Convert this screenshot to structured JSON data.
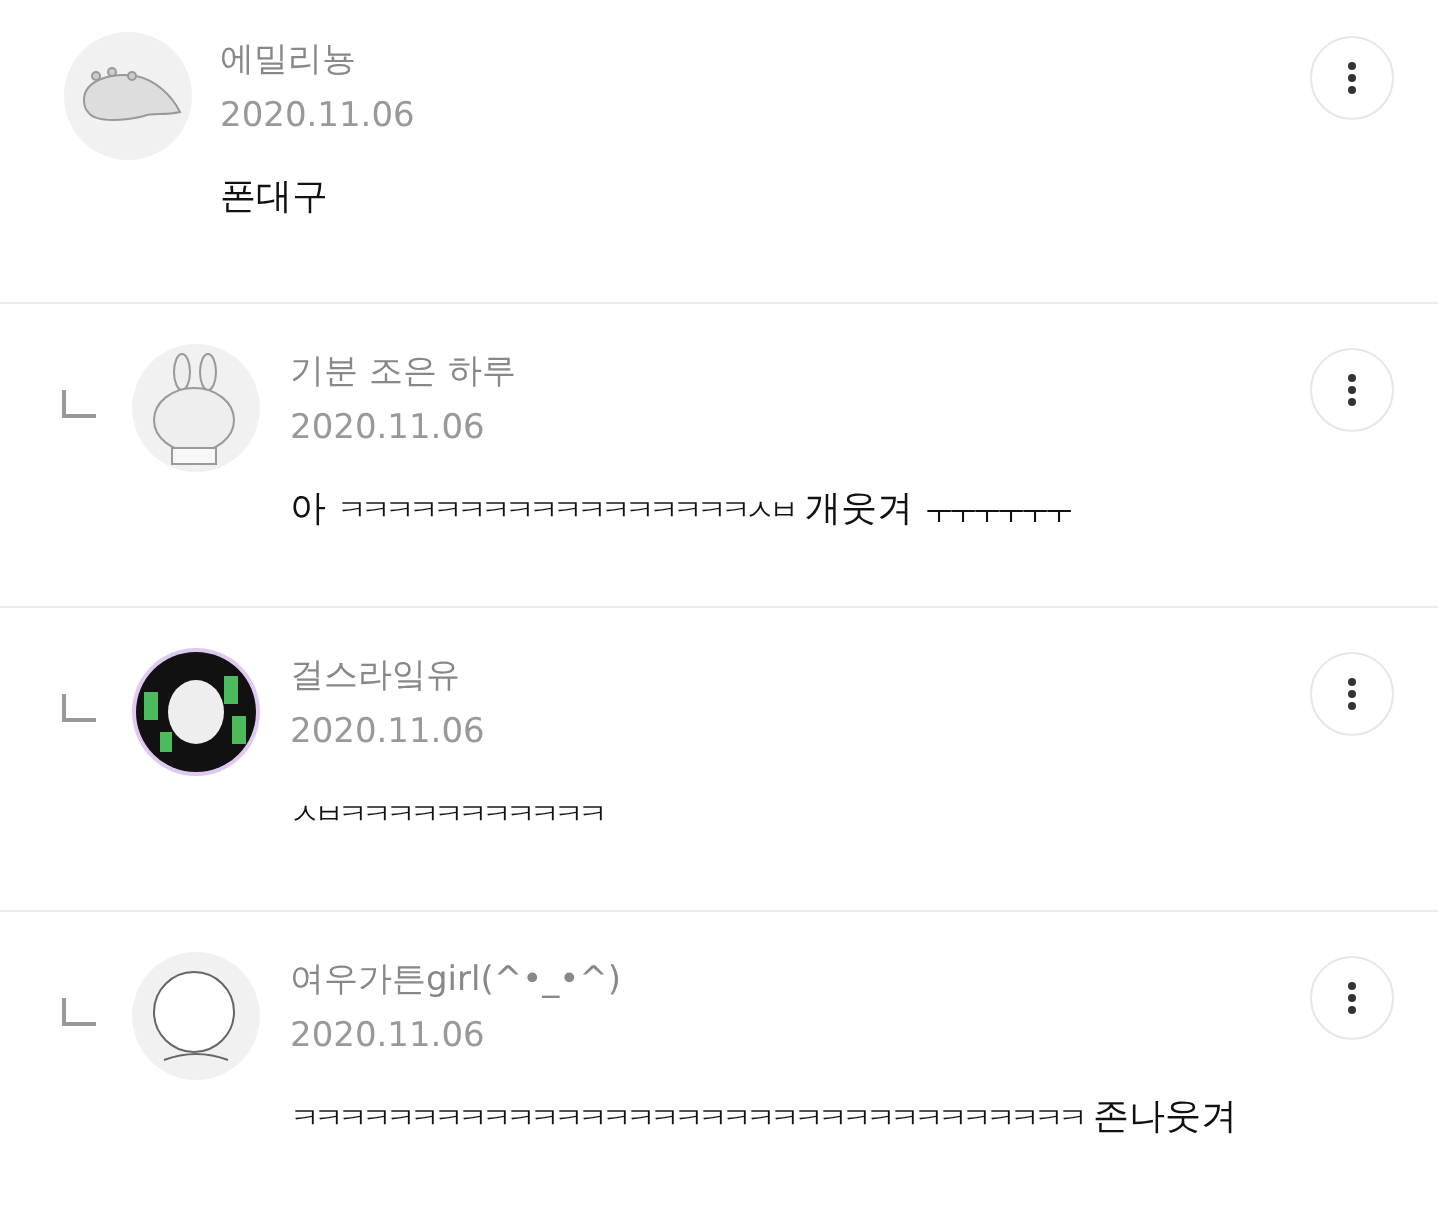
{
  "comments": [
    {
      "kind": "comment",
      "author": "에밀리뇽",
      "date": "2020.11.06",
      "text": "폰대구"
    },
    {
      "kind": "reply",
      "author": "기분 조은 하루",
      "date": "2020.11.06",
      "text": "아 ㅋㅋㅋㅋㅋㅋㅋㅋㅋㅋㅋㅋㅋㅋㅋㅋㅋㅅㅂ 개웃겨 ㅜㅜㅜㅜㅜㅜ"
    },
    {
      "kind": "reply",
      "author": "걸스라잌유",
      "date": "2020.11.06",
      "text": "ㅅㅂㅋㅋㅋㅋㅋㅋㅋㅋㅋㅋㅋ"
    },
    {
      "kind": "reply",
      "author": "여우가튼girl(^•_•^)",
      "date": "2020.11.06",
      "text": "ㅋㅋㅋㅋㅋㅋㅋㅋㅋㅋㅋㅋㅋㅋㅋㅋㅋㅋㅋㅋㅋㅋㅋㅋㅋㅋㅋㅋㅋㅋㅋㅋㅋ 존나웃겨"
    }
  ]
}
